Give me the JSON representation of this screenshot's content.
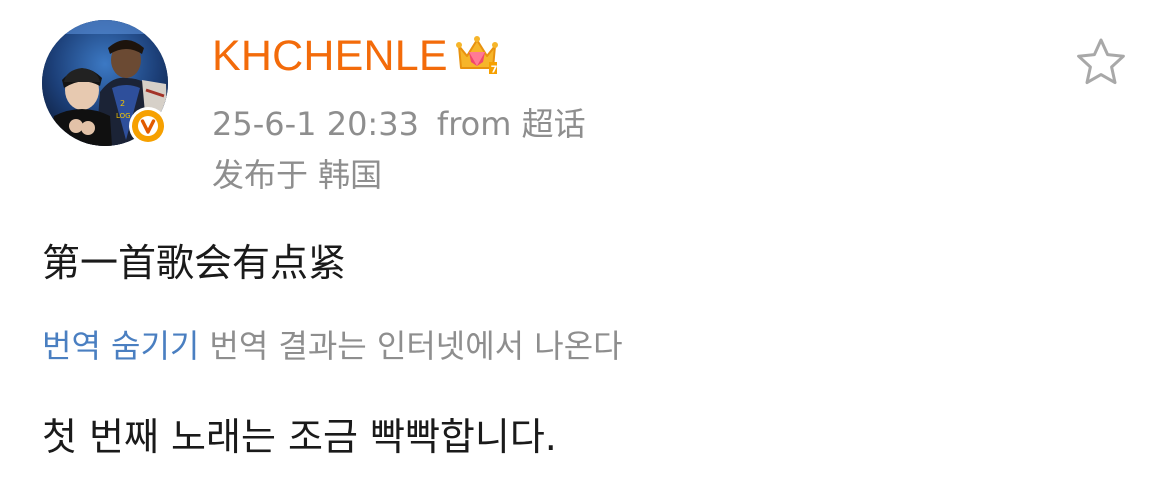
{
  "post": {
    "username": "KHCHENLE",
    "timestamp": "25-6-1 20:33",
    "source": "from 超话",
    "location": "发布于 韩国",
    "text": "第一首歌会有点紧",
    "translation": {
      "hide_label": "번역 숨기기",
      "source_note": "번역 결과는 인터넷에서 나온다",
      "text": "첫 번째 노래는 조금 빡빡합니다."
    }
  },
  "icons": {
    "avatar": "user-avatar-photo",
    "verified": "orange-v-verified-badge",
    "member": "crown-member-icon",
    "favorite": "star-outline-icon"
  },
  "colors": {
    "username": "#f36b0a",
    "meta": "#8e8e8e",
    "link": "#4a7fc1",
    "text": "#1a1a1a",
    "badge": "#f6a000"
  }
}
